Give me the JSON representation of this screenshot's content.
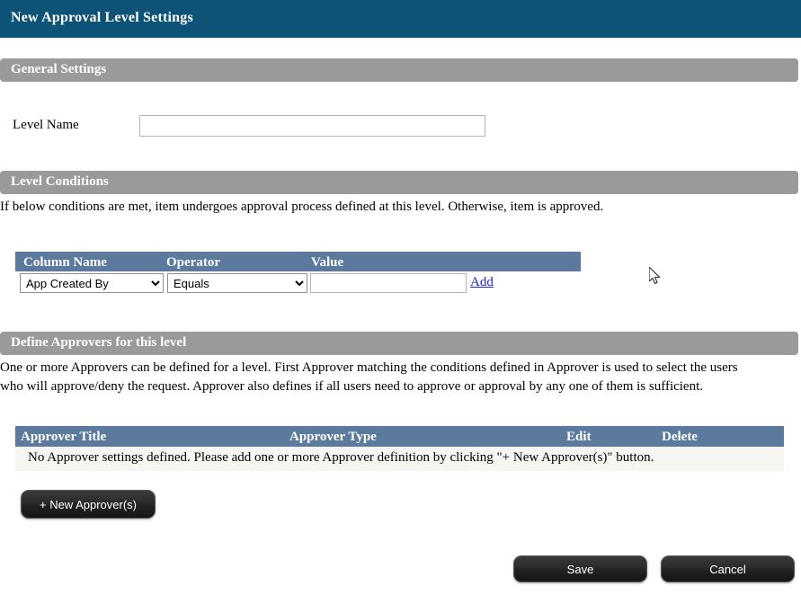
{
  "window": {
    "title": "New Approval Level Settings",
    "accent_color": "#0d5378",
    "section_bar_color": "#9a9a9a",
    "table_header_color": "#5b7a9e"
  },
  "general_settings": {
    "section_title": "General Settings",
    "level_name_label": "Level Name",
    "level_name_value": "",
    "level_name_placeholder": ""
  },
  "level_conditions": {
    "section_title": "Level Conditions",
    "description": "If below conditions are met, item undergoes approval process defined at this level. Otherwise, item is approved.",
    "columns": [
      "Column Name",
      "Operator",
      "Value"
    ],
    "row": {
      "column_name_selected": "App Created By",
      "column_name_options": [
        "App Created By"
      ],
      "operator_selected": "Equals",
      "operator_options": [
        "Equals"
      ],
      "value": "",
      "value_placeholder": "",
      "add_link": "Add"
    }
  },
  "approvers": {
    "section_title": "Define Approvers for this level",
    "description_line1": "One or more Approvers can be defined for a level. First Approver matching the conditions defined in Approver is used to select the users",
    "description_line2": "who will approve/deny the request. Approver also defines if all users need to approve or approval by any one of them is sufficient.",
    "columns": [
      "Approver Title",
      "Approver Type",
      "Edit",
      "Delete"
    ],
    "empty_message": "No Approver settings defined. Please add one or more Approver definition by clicking \"+ New Approver(s)\" button.",
    "new_approver_button": "+ New Approver(s)"
  },
  "footer": {
    "save_label": "Save",
    "cancel_label": "Cancel"
  }
}
